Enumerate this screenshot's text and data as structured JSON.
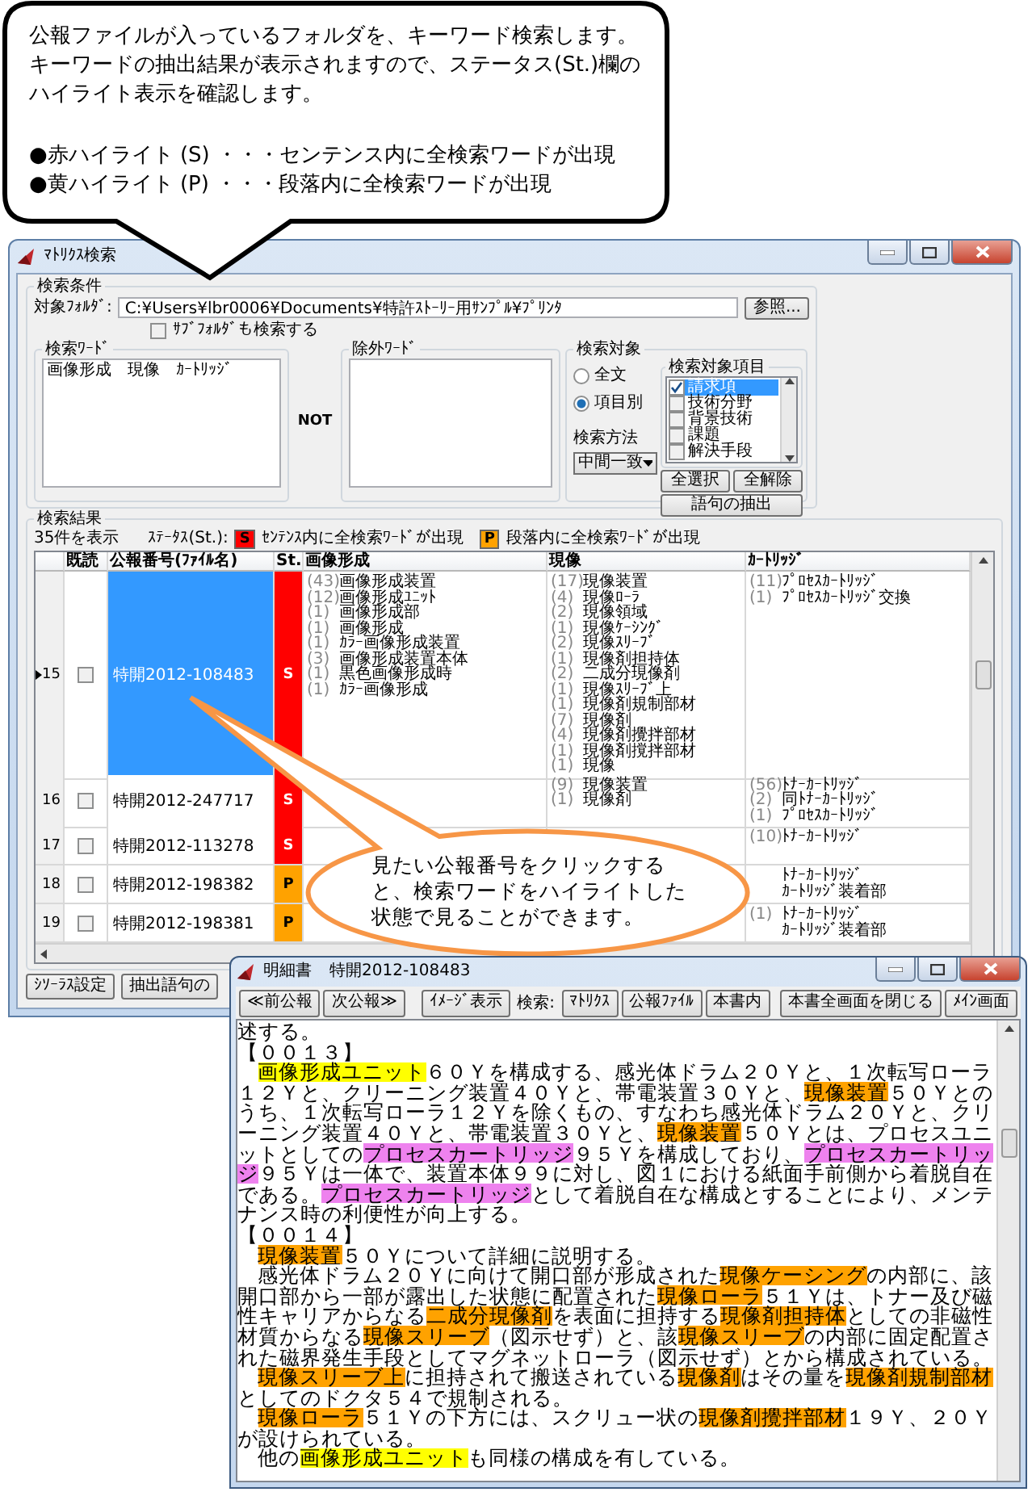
{
  "callout_top": {
    "paragraph": "公報ファイルが入っているフォルダを、キーワード検索します。キーワードの抽出結果が表示されますので、ステータス(St.)欄のハイライト表示を確認します。",
    "bullets": [
      "●赤ハイライト (S) ・・・センテンス内に全検索ワードが出現",
      "●黄ハイライト (P) ・・・段落内に全検索ワードが出現"
    ]
  },
  "main_window": {
    "title": "ﾏﾄﾘｸｽ検索",
    "conditions": {
      "legend": "検索条件",
      "folder_label": "対象ﾌｫﾙﾀﾞ:",
      "folder_path": "C:¥Users¥lbr0006¥Documents¥特許ｽﾄｰﾘｰ用ｻﾝﾌﾟﾙ¥ﾌﾟﾘﾝﾀ",
      "browse_button": "参照...",
      "subfolder": {
        "label": "ｻﾌﾞﾌｫﾙﾀﾞも検索する",
        "checked": false
      },
      "search_words": {
        "legend": "検索ﾜｰﾄﾞ",
        "value": "画像形成　現像　ｶｰﾄﾘｯｼﾞ"
      },
      "not_label": "NOT",
      "exclude_words": {
        "legend": "除外ﾜｰﾄﾞ"
      },
      "target": {
        "legend": "検索対象",
        "options": [
          {
            "label": "全文",
            "selected": false
          },
          {
            "label": "項目別",
            "selected": true
          }
        ],
        "method_label": "検索方法",
        "method_value": "中間一致",
        "items_legend": "検索対象項目",
        "items": [
          {
            "label": "請求項",
            "checked": true,
            "selected": true
          },
          {
            "label": "技術分野",
            "checked": false,
            "selected": false
          },
          {
            "label": "背景技術",
            "checked": false,
            "selected": false
          },
          {
            "label": "課題",
            "checked": false,
            "selected": false
          },
          {
            "label": "解決手段",
            "checked": false,
            "selected": false
          }
        ],
        "select_all_button": "全選択",
        "clear_all_button": "全解除",
        "extract_button": "語句の抽出"
      }
    },
    "results": {
      "legend": "検索結果",
      "count": "35件を表示",
      "status_label": "ｽﾃｰﾀｽ(St.):",
      "status_legend": [
        {
          "badge": "S",
          "text": "ｾﾝﾃﾝｽ内に全検索ﾜｰﾄﾞが出現",
          "color": "#ff0000"
        },
        {
          "badge": "P",
          "text": "段落内に全検索ﾜｰﾄﾞが出現",
          "color": "#ffa200"
        }
      ]
    },
    "table": {
      "columns": [
        "既読",
        "公報番号(ﾌｧｲﾙ名)",
        "St.",
        "画像形成",
        "現像",
        "ｶｰﾄﾘｯｼﾞ"
      ],
      "rows": [
        {
          "number": "15",
          "read": false,
          "selected": true,
          "publication": "特開2012-108483",
          "status": "S",
          "color": "#ff0000",
          "image": [
            {
              "count": "(43)",
              "term": "画像形成装置"
            },
            {
              "count": "(12)",
              "term": "画像形成ﾕﾆｯﾄ"
            },
            {
              "count": "(1)",
              "term": "画像形成部"
            },
            {
              "count": "(1)",
              "term": "画像形成"
            },
            {
              "count": "(1)",
              "term": "ｶﾗｰ画像形成装置"
            },
            {
              "count": "(3)",
              "term": "画像形成装置本体"
            },
            {
              "count": "(1)",
              "term": "黒色画像形成時"
            },
            {
              "count": "(1)",
              "term": "ｶﾗｰ画像形成"
            }
          ],
          "develop": [
            {
              "count": "(17)",
              "term": "現像装置"
            },
            {
              "count": "(4)",
              "term": "現像ﾛｰﾗ"
            },
            {
              "count": "(2)",
              "term": "現像領域"
            },
            {
              "count": "(1)",
              "term": "現像ｹｰｼﾝｸﾞ"
            },
            {
              "count": "(2)",
              "term": "現像ｽﾘｰﾌﾞ"
            },
            {
              "count": "(1)",
              "term": "現像剤担持体"
            },
            {
              "count": "(2)",
              "term": "二成分現像剤"
            },
            {
              "count": "(1)",
              "term": "現像ｽﾘｰﾌﾞ上"
            },
            {
              "count": "(1)",
              "term": "現像剤規制部材"
            },
            {
              "count": "(7)",
              "term": "現像剤"
            },
            {
              "count": "(4)",
              "term": "現像剤攪拌部材"
            },
            {
              "count": "(1)",
              "term": "現像剤撹拌部材"
            },
            {
              "count": "(1)",
              "term": "現像"
            }
          ],
          "cartridge": [
            {
              "count": "(11)",
              "term": "ﾌﾟﾛｾｽｶｰﾄﾘｯｼﾞ"
            },
            {
              "count": "(1)",
              "term": "ﾌﾟﾛｾｽｶｰﾄﾘｯｼﾞ交換"
            }
          ]
        },
        {
          "number": "16",
          "read": false,
          "selected": false,
          "publication": "特開2012-247717",
          "status": "S",
          "color": "#ff0000",
          "develop": [
            {
              "count": "(9)",
              "term": "現像装置"
            },
            {
              "count": "(1)",
              "term": "現像剤"
            }
          ],
          "cartridge": [
            {
              "count": "(56)",
              "term": "ﾄﾅｰｶｰﾄﾘｯｼﾞ"
            },
            {
              "count": "(2)",
              "term": "同ﾄﾅｰｶｰﾄﾘｯｼﾞ"
            },
            {
              "count": "(1)",
              "term": "ﾌﾟﾛｾｽｶｰﾄﾘｯｼﾞ"
            }
          ]
        },
        {
          "number": "17",
          "read": false,
          "selected": false,
          "publication": "特開2012-113278",
          "status": "S",
          "color": "#ff0000",
          "cartridge": [
            {
              "count": "(10)",
              "term": "ﾄﾅｰｶｰﾄﾘｯｼﾞ"
            }
          ]
        },
        {
          "number": "18",
          "read": false,
          "selected": false,
          "publication": "特開2012-198382",
          "status": "P",
          "color": "#ffa200",
          "cartridge": [
            {
              "term": "ﾄﾅｰｶｰﾄﾘｯｼﾞ"
            },
            {
              "term": "ｶｰﾄﾘｯｼﾞ装着部"
            }
          ]
        },
        {
          "number": "19",
          "read": false,
          "selected": false,
          "publication": "特開2012-198381",
          "status": "P",
          "color": "#ffa200",
          "cartridge": [
            {
              "count": "(1)",
              "term": "ﾄﾅｰｶｰﾄﾘｯｼﾞ"
            },
            {
              "term": "ｶｰﾄﾘｯｼﾞ装着部"
            }
          ]
        }
      ]
    },
    "bottom_buttons": [
      "ｼｿｰﾗｽ設定",
      "抽出語句の"
    ]
  },
  "callout_bottom": {
    "text": "見たい公報番号をクリックすると、検索ワードをハイライトした状態で見ることができます。"
  },
  "detail_window": {
    "title": "明細書",
    "document": "特開2012-108483",
    "nav_buttons": [
      "≪前公報",
      "次公報≫"
    ],
    "image_button": "ｲﾒｰｼﾞ表示",
    "search_label": "検索:",
    "search_buttons": [
      "ﾏﾄﾘｸｽ",
      "公報ﾌｧｲﾙ",
      "本書内"
    ],
    "right_buttons": [
      "本書全画面を閉じる",
      "ﾒｲﾝ画面"
    ],
    "paragraphs": [
      {
        "indent": false,
        "segments": [
          {
            "text": "述する。"
          }
        ]
      },
      {
        "indent": false,
        "segments": [
          {
            "text": "【００１３】"
          }
        ]
      },
      {
        "indent": true,
        "segments": [
          {
            "text": "画像形成ユニット",
            "color": "#ffff00"
          },
          {
            "text": "６０Ｙを構成する、感光体ドラム２０Ｙと、１次転写ローラ１２Ｙと、クリーニング装置４０Ｙと、帯電装置３０Ｙと、"
          },
          {
            "text": "現像装置",
            "color": "#ffa200"
          },
          {
            "text": "５０Ｙとのうち、１次転写ローラ１２Ｙを除くもの、すなわち感光体ドラム２０Ｙと、クリーニング装置４０Ｙと、帯電装置３０Ｙと、"
          },
          {
            "text": "現像装置",
            "color": "#ffa200"
          },
          {
            "text": "５０Ｙとは、プロセスユニットとしての"
          },
          {
            "text": "プロセスカートリッジ",
            "color": "#ee82ee"
          },
          {
            "text": "９５Ｙを構成しており、"
          },
          {
            "text": "プロセスカートリッジ",
            "color": "#ee82ee"
          },
          {
            "text": "９５Ｙは一体で、装置本体９９に対し、図１における紙面手前側から着脱自在である。"
          },
          {
            "text": "プロセスカートリッジ",
            "color": "#ee82ee"
          },
          {
            "text": "として着脱自在な構成とすることにより、メンテナンス時の利便性が向上する。"
          }
        ]
      },
      {
        "indent": false,
        "segments": [
          {
            "text": "【００１４】"
          }
        ]
      },
      {
        "indent": true,
        "segments": [
          {
            "text": "現像装置",
            "color": "#ffa200"
          },
          {
            "text": "５０Ｙについて詳細に説明する。"
          }
        ]
      },
      {
        "indent": true,
        "segments": [
          {
            "text": "感光体ドラム２０Ｙに向けて開口部が形成された"
          },
          {
            "text": "現像ケーシング",
            "color": "#ffa200"
          },
          {
            "text": "の内部に、該開口部から一部が露出した状態に配置された"
          },
          {
            "text": "現像ローラ",
            "color": "#ffa200"
          },
          {
            "text": "５１Ｙは、トナー及び磁性キャリアからなる"
          },
          {
            "text": "二成分現像剤",
            "color": "#ffa200"
          },
          {
            "text": "を表面に担持する"
          },
          {
            "text": "現像剤担持体",
            "color": "#ffa200"
          },
          {
            "text": "としての非磁性材質からなる"
          },
          {
            "text": "現像スリーブ",
            "color": "#ffa200"
          },
          {
            "text": "（図示せず）と、該"
          },
          {
            "text": "現像スリーブ",
            "color": "#ffa200"
          },
          {
            "text": "の内部に固定配置された磁界発生手段としてマグネットローラ（図示せず）とから構成されている。"
          }
        ]
      },
      {
        "indent": true,
        "segments": [
          {
            "text": "現像スリーブ上",
            "color": "#ffa200"
          },
          {
            "text": "に担持されて搬送されている"
          },
          {
            "text": "現像剤",
            "color": "#ffa200"
          },
          {
            "text": "はその量を"
          },
          {
            "text": "現像剤規制部材",
            "color": "#ffa200"
          },
          {
            "text": "としてのドクタ５４で規制される。"
          }
        ]
      },
      {
        "indent": true,
        "segments": [
          {
            "text": "現像ローラ",
            "color": "#ffa200"
          },
          {
            "text": "５１Ｙの下方には、スクリュー状の"
          },
          {
            "text": "現像剤攪拌部材",
            "color": "#ffa200"
          },
          {
            "text": "１９Ｙ、２０Ｙが設けられている。"
          }
        ]
      },
      {
        "indent": true,
        "segments": [
          {
            "text": "他の"
          },
          {
            "text": "画像形成ユニット",
            "color": "#ffff00"
          },
          {
            "text": "も同様の構成を有している。"
          }
        ]
      }
    ]
  }
}
